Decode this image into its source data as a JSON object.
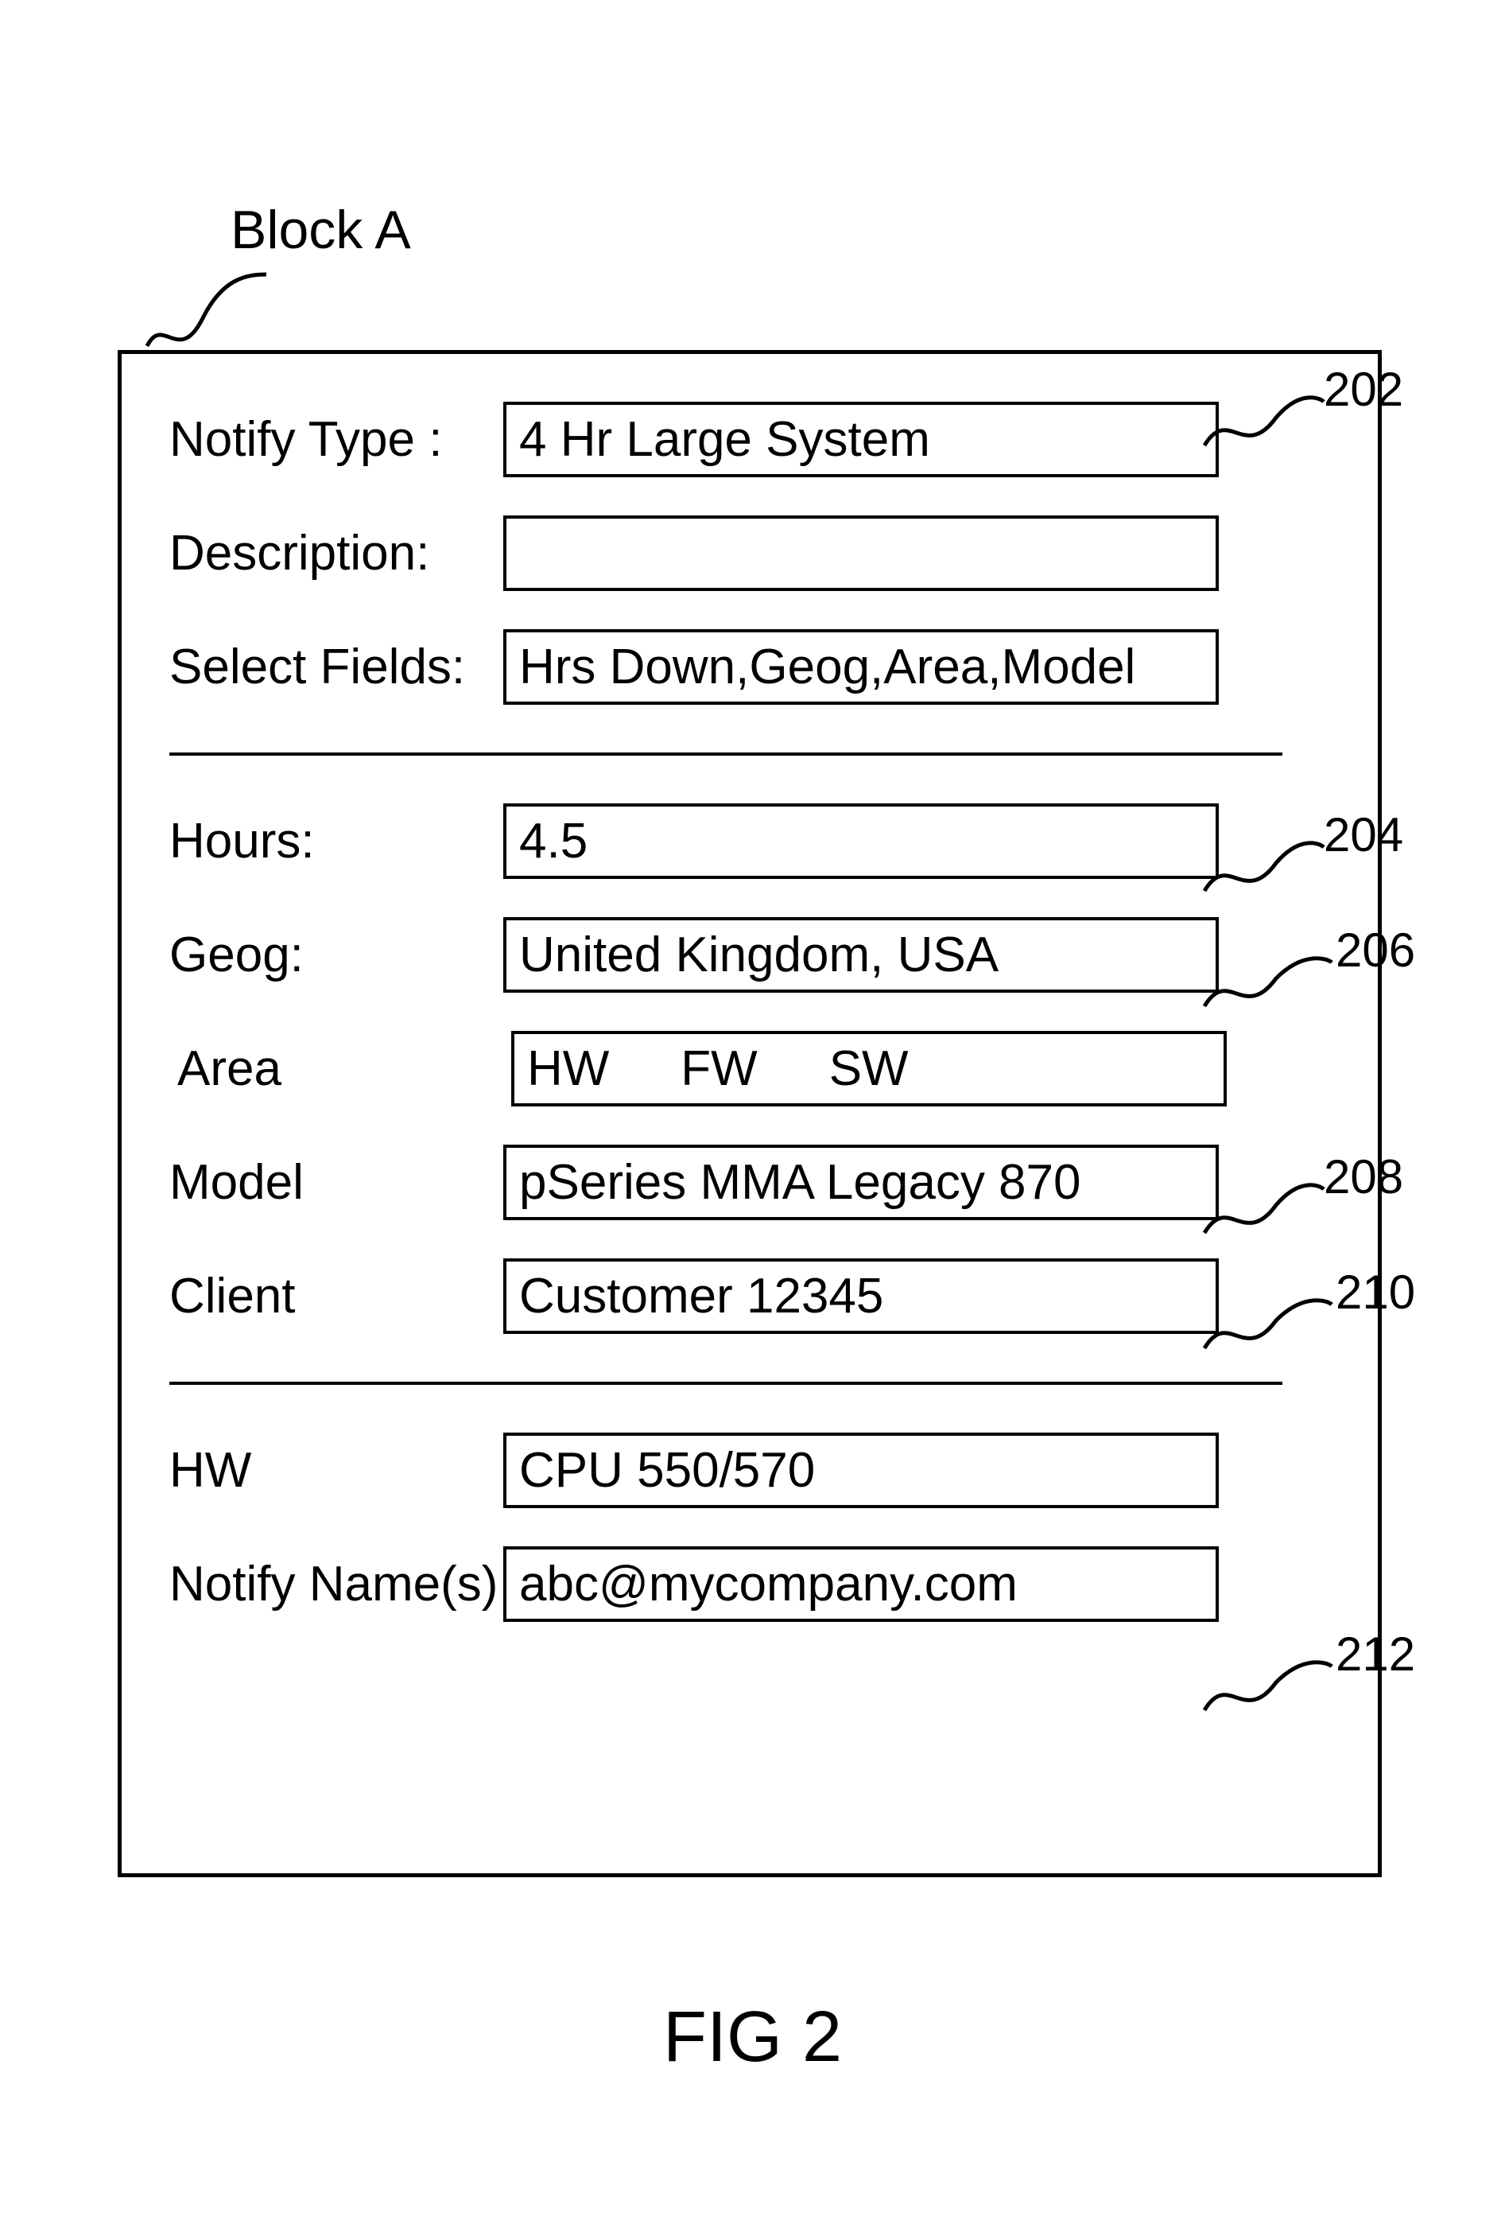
{
  "blockLabel": "Block A",
  "figCaption": "FIG 2",
  "section1": {
    "notifyType": {
      "label": "Notify Type :",
      "value": "4 Hr Large System"
    },
    "description": {
      "label": "Description:",
      "value": ""
    },
    "selectFields": {
      "label": "Select Fields:",
      "value": "Hrs Down,Geog,Area,Model"
    }
  },
  "section2": {
    "hours": {
      "label": "Hours:",
      "value": "4.5"
    },
    "geog": {
      "label": "Geog:",
      "value": "United Kingdom, USA"
    },
    "area": {
      "label": "Area",
      "values": [
        "HW",
        "FW",
        "SW"
      ]
    },
    "model": {
      "label": "Model",
      "value": "pSeries MMA Legacy 870"
    },
    "client": {
      "label": "Client",
      "value": "Customer 12345"
    }
  },
  "section3": {
    "hw": {
      "label": "HW",
      "value": "CPU 550/570"
    },
    "notify": {
      "label": "Notify Name(s)",
      "value": "abc@mycompany.com"
    }
  },
  "refs": {
    "r202": "202",
    "r204": "204",
    "r206": "206",
    "r208": "208",
    "r210": "210",
    "r212": "212"
  }
}
